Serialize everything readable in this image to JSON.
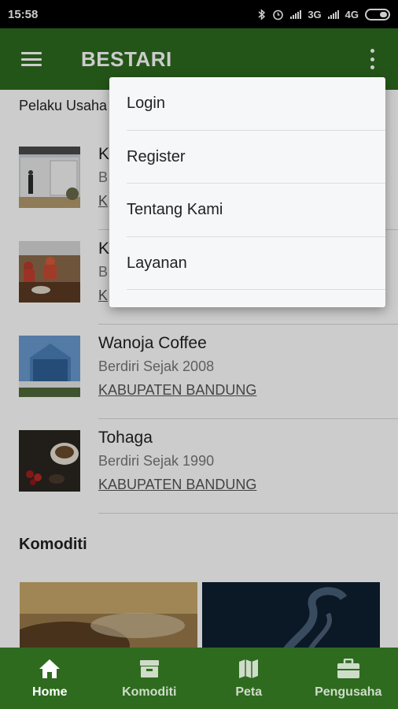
{
  "status_bar": {
    "time": "15:58",
    "network1": "3G",
    "network2": "4G"
  },
  "app_bar": {
    "title": "BESTARI"
  },
  "section": {
    "title": "Pelaku Usaha"
  },
  "items": [
    {
      "name": "K",
      "since": "B",
      "location": "K"
    },
    {
      "name": "K",
      "since": "B",
      "location": "K"
    },
    {
      "name": "Wanoja Coffee",
      "since": "Berdiri Sejak 2008",
      "location": "KABUPATEN BANDUNG"
    },
    {
      "name": "Tohaga",
      "since": "Berdiri Sejak 1990",
      "location": "KABUPATEN BANDUNG"
    }
  ],
  "komoditi": {
    "title": "Komoditi"
  },
  "menu": {
    "items": [
      {
        "label": "Login"
      },
      {
        "label": "Register"
      },
      {
        "label": "Tentang Kami"
      },
      {
        "label": "Layanan"
      }
    ]
  },
  "bottom_nav": {
    "items": [
      {
        "label": "Home",
        "icon": "home-icon",
        "active": true
      },
      {
        "label": "Komoditi",
        "icon": "box-icon"
      },
      {
        "label": "Peta",
        "icon": "map-icon"
      },
      {
        "label": "Pengusaha",
        "icon": "briefcase-icon"
      }
    ]
  },
  "colors": {
    "primary": "#2e6b1f",
    "menu_bg": "#f6f7f9"
  }
}
